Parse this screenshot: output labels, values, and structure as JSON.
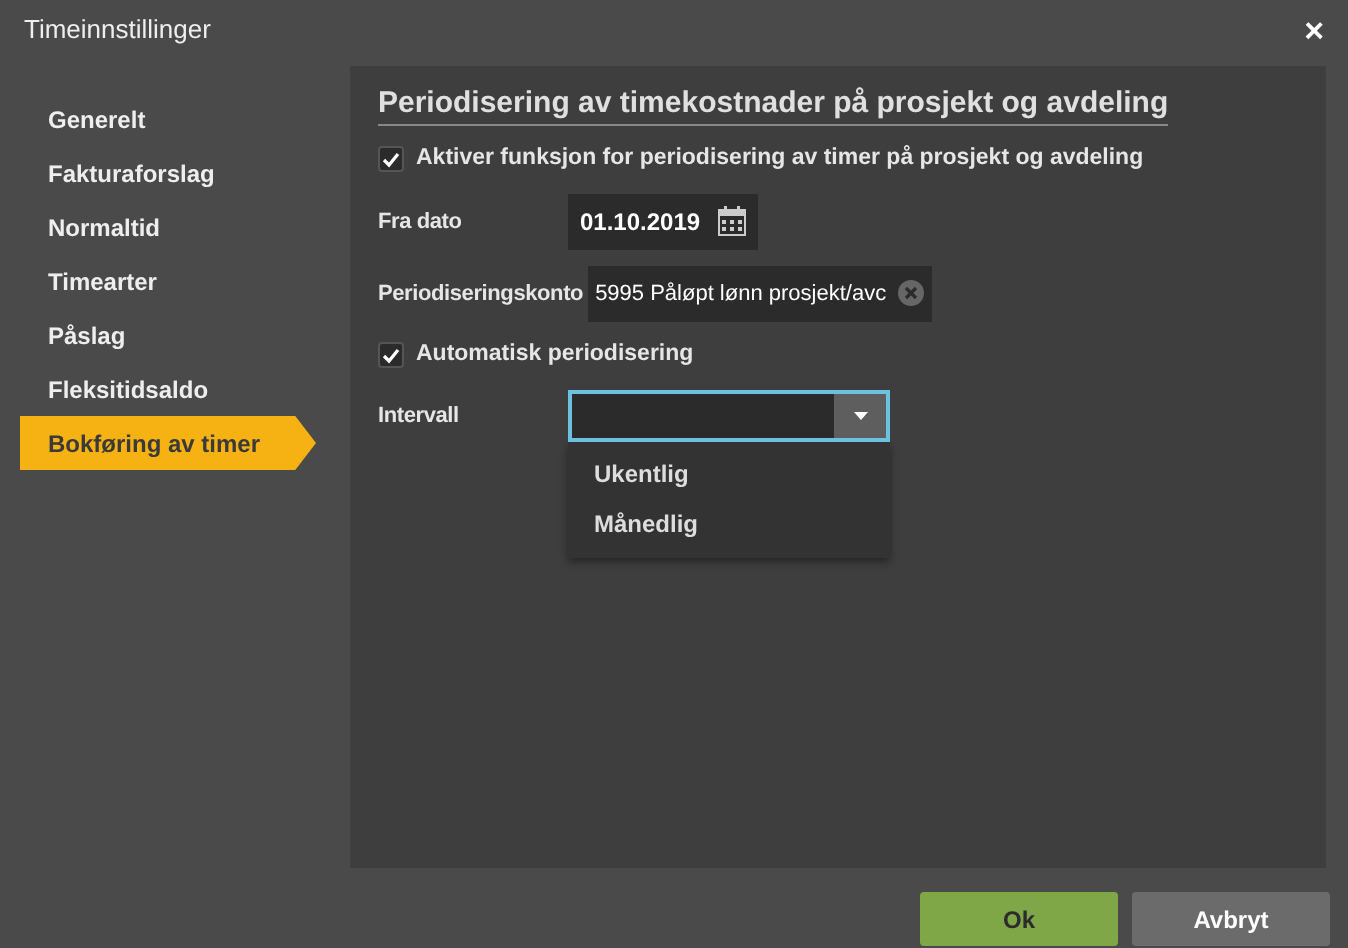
{
  "window": {
    "title": "Timeinnstillinger",
    "close": "×"
  },
  "sidebar": {
    "items": [
      {
        "label": "Generelt",
        "selected": false
      },
      {
        "label": "Fakturaforslag",
        "selected": false
      },
      {
        "label": "Normaltid",
        "selected": false
      },
      {
        "label": "Timearter",
        "selected": false
      },
      {
        "label": "Påslag",
        "selected": false
      },
      {
        "label": "Fleksitidsaldo",
        "selected": false
      },
      {
        "label": "Bokføring av timer",
        "selected": true
      }
    ]
  },
  "panel": {
    "heading": "Periodisering av timekostnader på prosjekt og avdeling",
    "rows": [
      {
        "kind": "checkbox",
        "label": "Aktiver funksjon for periodisering av timer på prosjekt og avdeling",
        "checked": true
      },
      {
        "kind": "date",
        "label": "Fra dato",
        "value": "01.10.2019"
      },
      {
        "kind": "lookup",
        "label": "Periodiseringskonto",
        "value": "5995 Påløpt lønn prosjekt/avc"
      },
      {
        "kind": "checkbox",
        "label": "Automatisk periodisering",
        "checked": true
      },
      {
        "kind": "select",
        "label": "Intervall",
        "value": "",
        "expanded": true,
        "options": [
          "Ukentlig",
          "Månedlig"
        ]
      }
    ]
  },
  "buttons": [
    {
      "label": "Ok",
      "kind": "primary"
    },
    {
      "label": "Avbryt",
      "kind": "secondary"
    }
  ]
}
